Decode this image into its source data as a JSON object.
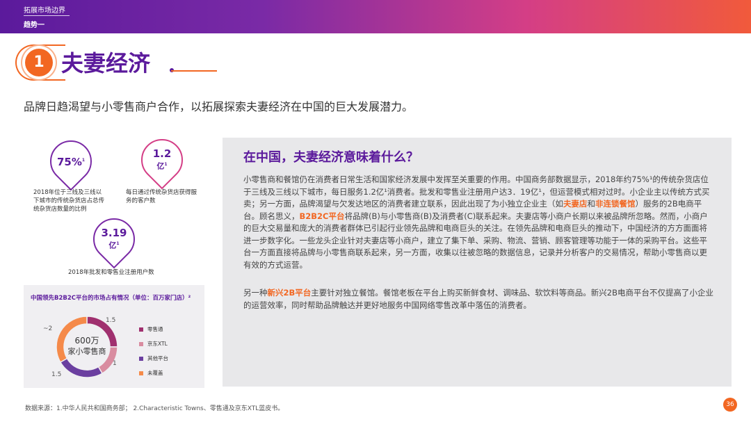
{
  "header": {
    "breadcrumb": "拓展市场边界",
    "trend": "趋势一"
  },
  "section": {
    "number": "1",
    "title": "夫妻经济"
  },
  "lead": "品牌日趋渴望与小零售商户合作，以拓展探索夫妻经济在中国的巨大发展潜力。",
  "stats": [
    {
      "value": "75%",
      "sup": "1",
      "desc": "2018年位于三线及三线以下城市的传统杂货店占总传统杂货店数量的比例"
    },
    {
      "value": "1.2",
      "unit": "亿",
      "sup": "1",
      "desc": "每日通过传统杂货店获得服务的客户数"
    },
    {
      "value": "3.19",
      "unit": "亿",
      "sup": "1",
      "desc": "2018年批发和零售业注册用户数"
    }
  ],
  "share": {
    "title": "中国领先B2B2C平台的市场占有情况（单位：百万家门店）²",
    "center_value": "600万",
    "center_label": "家小零售商",
    "labels": [
      "1.5",
      "1",
      "1.5",
      "~2"
    ],
    "legend": [
      {
        "name": "零售通",
        "color": "#a0306f"
      },
      {
        "name": "京东XTL",
        "color": "#d98ca0"
      },
      {
        "name": "其他平台",
        "color": "#6b3fa0"
      },
      {
        "name": "未覆盖",
        "color": "#f58a4a"
      }
    ]
  },
  "info": {
    "title": "在中国，夫妻经济意味着什么？",
    "p1_a": "小零售商和餐馆仍在消费者日常生活和国家经济发展中发挥至关重要的作用。中国商务部数据显示，2018年约75%¹的传统杂货店位于三线及三线以下城市，每日服务1.2亿¹消费者。批发和零售业注册用户达3．19亿¹，但运营模式相对过时。小企业主以传统方式买卖；另一方面，品牌渴望与欠发达地区的消费者建立联系，因此出现了为小独立企业主（如",
    "p1_hl1": "夫妻店",
    "p1_b": "和",
    "p1_hl2": "非连锁餐馆",
    "p1_c": "）服务的2B电商平台。顾名思义，",
    "p1_hl3": "B2B2C平台",
    "p1_d": "将品牌(B)与小零售商(B)及消费者(C)联系起来。夫妻店等小商户长期以来被品牌所忽略。然而，小商户的巨大交易量和庞大的消费者群体已引起行业领先品牌和电商巨头的关注。在领先品牌和电商巨头的推动下，中国经济的方方面面将进一步数字化。一些龙头企业针对夫妻店等小商户，建立了集下单、采购、物流、营销、顾客管理等功能于一体的采购平台。这些平台一方面直接将品牌与小零售商联系起来，另一方面，收集以往被忽略的数据信息，记录并分析客户的交易情况，帮助小零售商以更有效的方式运营。",
    "p2_a": "另一种",
    "p2_hl": "新兴2B平台",
    "p2_b": "主要针对独立餐馆。餐馆老板在平台上购买新鲜食材、调味品、软饮料等商品。新兴2B电商平台不仅提高了小企业的运营效率，同时帮助品牌触达并更好地服务中国网络零售改革中落伍的消费者。"
  },
  "footnote": "数据来源：1.中华人民共和国商务部； 2.Characteristic Towns、零售通及京东XTL蓝皮书。",
  "page": "36",
  "chart_data": {
    "type": "pie",
    "title": "中国领先B2B2C平台的市场占有情况（单位：百万家门店）²",
    "categories": [
      "零售通",
      "京东XTL",
      "其他平台",
      "未覆盖"
    ],
    "values": [
      1.5,
      1,
      1.5,
      2
    ]
  }
}
